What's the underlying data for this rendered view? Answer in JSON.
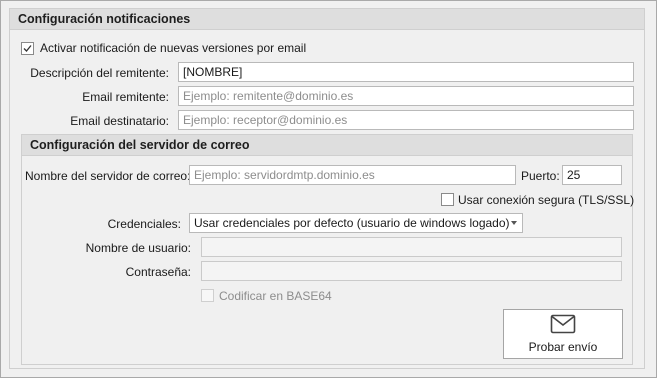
{
  "notifications": {
    "title": "Configuración notificaciones",
    "enable_label": "Activar notificación de nuevas versiones por email",
    "enable_checked": true,
    "sender_desc_label": "Descripción del remitente:",
    "sender_desc_value": "[NOMBRE]",
    "sender_email_label": "Email remitente:",
    "sender_email_placeholder": "Ejemplo: remitente@dominio.es",
    "recipient_email_label": "Email destinatario:",
    "recipient_email_placeholder": "Ejemplo: receptor@dominio.es"
  },
  "mail_server": {
    "title": "Configuración del servidor de correo",
    "server_label": "Nombre del servidor de correo:",
    "server_placeholder": "Ejemplo: servidordmtp.dominio.es",
    "port_label": "Puerto:",
    "port_value": "25",
    "secure_label": "Usar conexión segura (TLS/SSL)",
    "secure_checked": false,
    "credentials_label": "Credenciales:",
    "credentials_value": "Usar credenciales por defecto (usuario de windows logado)",
    "username_label": "Nombre de usuario:",
    "password_label": "Contraseña:",
    "base64_label": "Codificar en BASE64",
    "base64_checked": false,
    "test_button_label": "Probar envío",
    "test_button_icon": "envelope-icon"
  }
}
